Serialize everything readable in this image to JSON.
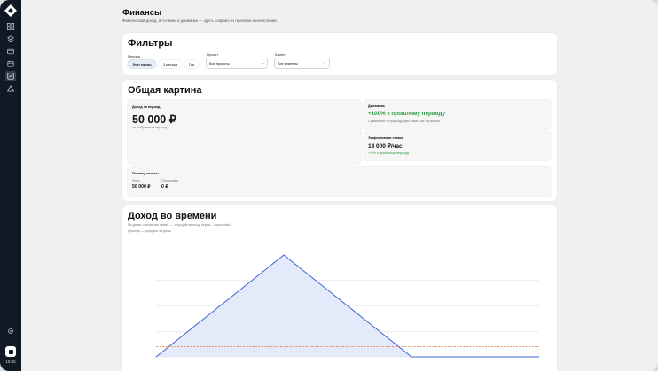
{
  "sidebar": {
    "time": "19:45",
    "icons": [
      "grid-icon",
      "layers-icon",
      "folder-icon",
      "calendar-icon",
      "finance-icon",
      "alert-icon"
    ],
    "active_index": 4
  },
  "page": {
    "title": "Финансы",
    "subtitle": "Фактический доход, источники и динамика — здесь собрано из проектов и начислений."
  },
  "filters": {
    "title": "Фильтры",
    "period_label": "Период",
    "period_options": [
      "Этот месяц",
      "3 месяца",
      "Год"
    ],
    "period_selected": "Этот месяц",
    "project_label": "Проект",
    "project_value": "Все проекты",
    "client_label": "Клиент",
    "client_value": "Все клиенты"
  },
  "overview": {
    "title": "Общая картина",
    "income_label": "Доход за период",
    "income_value": "50 000 ₽",
    "income_note": "за выбранный период",
    "dynamics_label": "Динамика",
    "dynamics_value": "+100% к прошлому периоду",
    "dynamics_note": "Сравнение с предыдущим таким же отрезком",
    "efficiency_label": "Эффективная ставка",
    "efficiency_value": "14 000 ₽/час",
    "efficiency_note": "+ 0% к прошлому периоду",
    "payment_title": "По типу оплаты",
    "payment_types": [
      {
        "label": "Фикс",
        "value": "50 000 ₽"
      },
      {
        "label": "Почасовка",
        "value": "0 ₽"
      }
    ]
  },
  "income_chart": {
    "title": "Доход во времени",
    "description_line1": "По дням: сплошная линия — текущий период, серая — прошлый,",
    "description_line2": "пунктир — среднее за день.",
    "colors": {
      "current": "#3b63d6",
      "fill": "#dfe6f9",
      "average": "#e0703a",
      "grid": "#dddddd"
    }
  },
  "chart_data": {
    "type": "line",
    "series": [
      {
        "values": [
          0,
          100,
          0,
          0
        ]
      }
    ],
    "x": [
      0,
      1,
      2,
      3
    ],
    "average": 10,
    "ylim": [
      0,
      100
    ],
    "grid": true
  }
}
